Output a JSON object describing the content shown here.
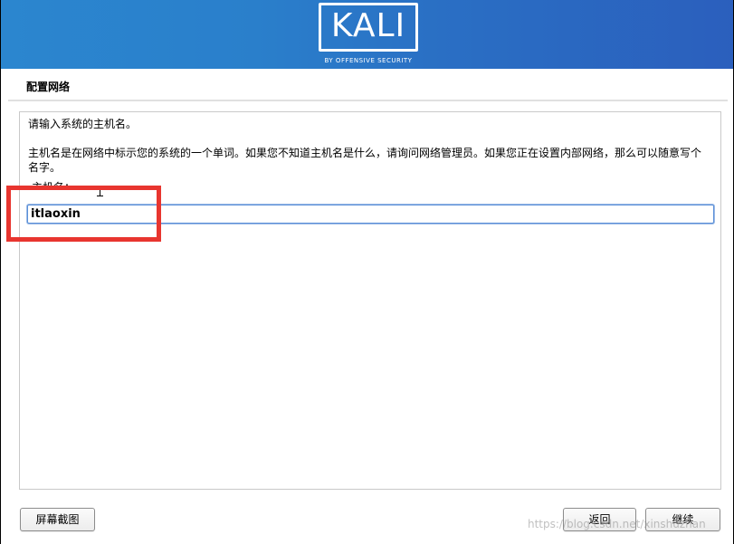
{
  "banner": {
    "logo_text": "KALI",
    "logo_subtext": "BY OFFENSIVE SECURITY",
    "gradient_start": "#2b86cf",
    "gradient_end": "#2b5fbd"
  },
  "page": {
    "title": "配置网络"
  },
  "content": {
    "prompt": "请输入系统的主机名。",
    "description": "主机名是在网络中标示您的系统的一个单词。如果您不知道主机名是什么，请询问网络管理员。如果您正在设置内部网络，那么可以随意写个名字。",
    "field_label": "主机名：",
    "hostname_value": "itlaoxin",
    "input_border_color": "#5a8fd8",
    "highlight_color": "#e8352f"
  },
  "buttons": {
    "screenshot": "屏幕截图",
    "back": "返回",
    "continue": "继续"
  },
  "watermark": "https://blog.csdn.net/xinshuzhan"
}
